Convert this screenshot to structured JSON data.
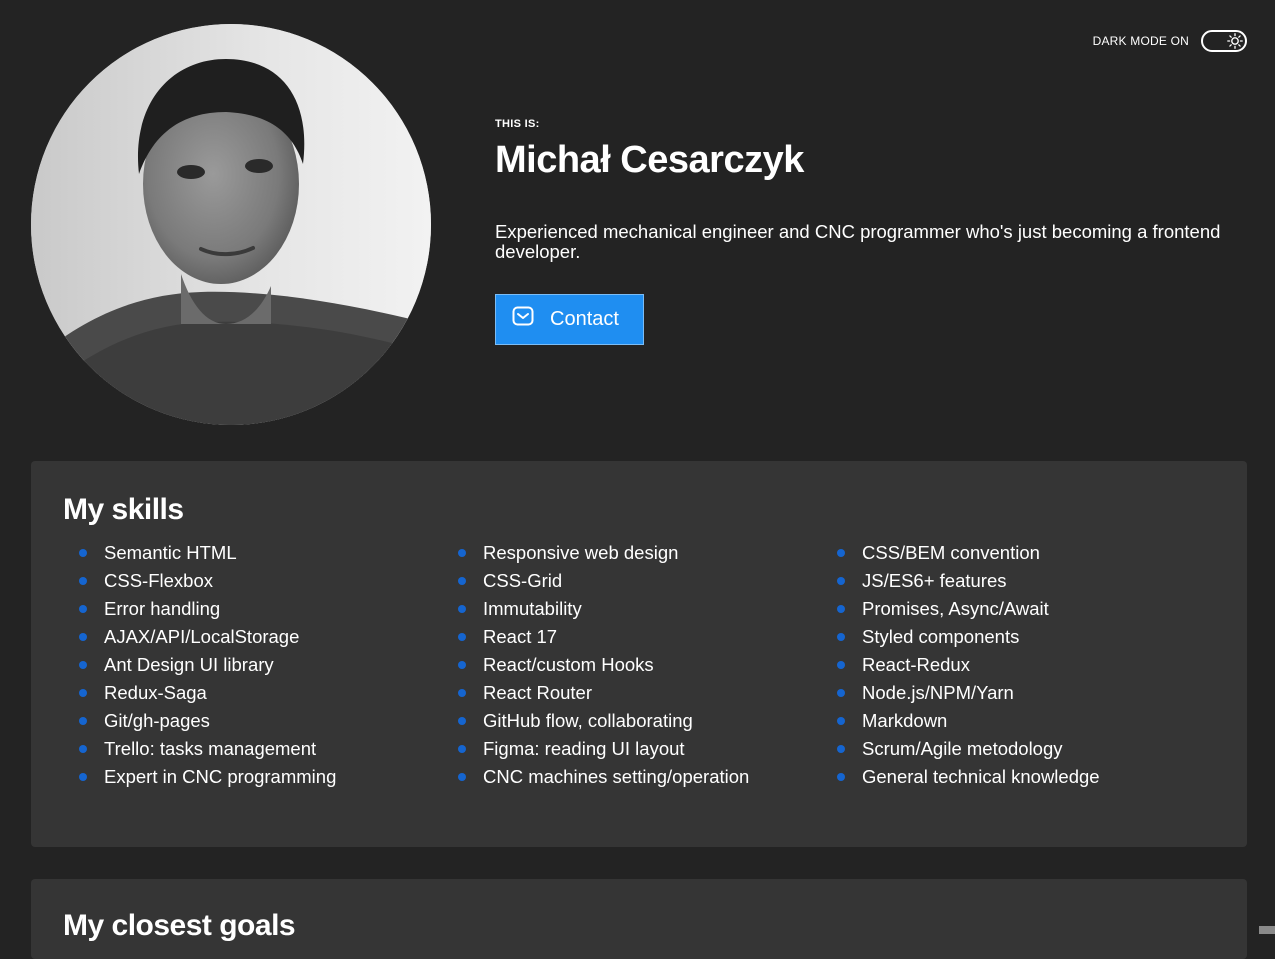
{
  "theme_toggle": {
    "label": "DARK MODE ON",
    "icon": "sun-icon",
    "state": "on"
  },
  "header": {
    "eyebrow": "THIS IS:",
    "name": "Michał Cesarczyk",
    "description": "Experienced mechanical engineer and CNC programmer who's just becoming a frontend developer.",
    "contact_button": {
      "label": "Contact",
      "icon": "mail-icon",
      "color": "#1f8ef1"
    }
  },
  "skills": {
    "title": "My skills",
    "bullet_color": "#1565d0",
    "columns": [
      [
        "Semantic HTML",
        "CSS-Flexbox",
        "Error handling",
        "AJAX/API/LocalStorage",
        "Ant Design UI library",
        "Redux-Saga",
        "Git/gh-pages",
        "Trello: tasks management",
        "Expert in CNC programming"
      ],
      [
        "Responsive web design",
        "CSS-Grid",
        "Immutability",
        "React 17",
        "React/custom Hooks",
        "React Router",
        "GitHub flow, collaborating",
        "Figma: reading UI layout",
        "CNC machines setting/operation"
      ],
      [
        "CSS/BEM convention",
        "JS/ES6+ features",
        "Promises, Async/Await",
        "Styled components",
        "React-Redux",
        "Node.js/NPM/Yarn",
        "Markdown",
        "Scrum/Agile metodology",
        "General technical knowledge"
      ]
    ]
  },
  "goals": {
    "title": "My closest goals"
  },
  "colors": {
    "background": "#232323",
    "panel": "#353535",
    "accent": "#1f8ef1"
  }
}
